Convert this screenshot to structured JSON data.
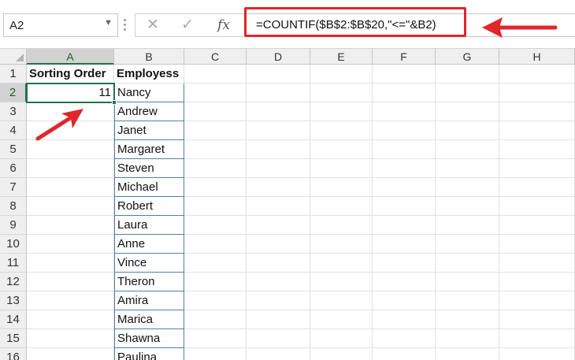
{
  "formula_bar": {
    "name_box": "A2",
    "cancel_icon": "✕",
    "enter_icon": "✓",
    "fx_label": "fx",
    "formula": "=COUNTIF($B$2:$B$20,\"<=\"&B2)"
  },
  "columns": [
    "A",
    "B",
    "C",
    "D",
    "E",
    "F",
    "G",
    "H"
  ],
  "rows": [
    "1",
    "2",
    "3",
    "4",
    "5",
    "6",
    "7",
    "8",
    "9",
    "10",
    "11",
    "12",
    "13",
    "14",
    "15",
    "16"
  ],
  "headers": {
    "a1": "Sorting Order",
    "b1": "Employess"
  },
  "a2_value": "11",
  "employees": [
    "Nancy",
    "Andrew",
    "Janet",
    "Margaret",
    "Steven",
    "Michael",
    "Robert",
    "Laura",
    "Anne",
    "Vince",
    "Theron",
    "Amira",
    "Marica",
    "Shawna",
    "Paulina"
  ],
  "colors": {
    "annotation_red": "#e0262b",
    "selection_green": "#217346"
  },
  "icons": [
    "cancel-icon",
    "enter-icon",
    "fx-icon",
    "dropdown-icon",
    "select-all-icon",
    "arrow-annotation-icon"
  ]
}
